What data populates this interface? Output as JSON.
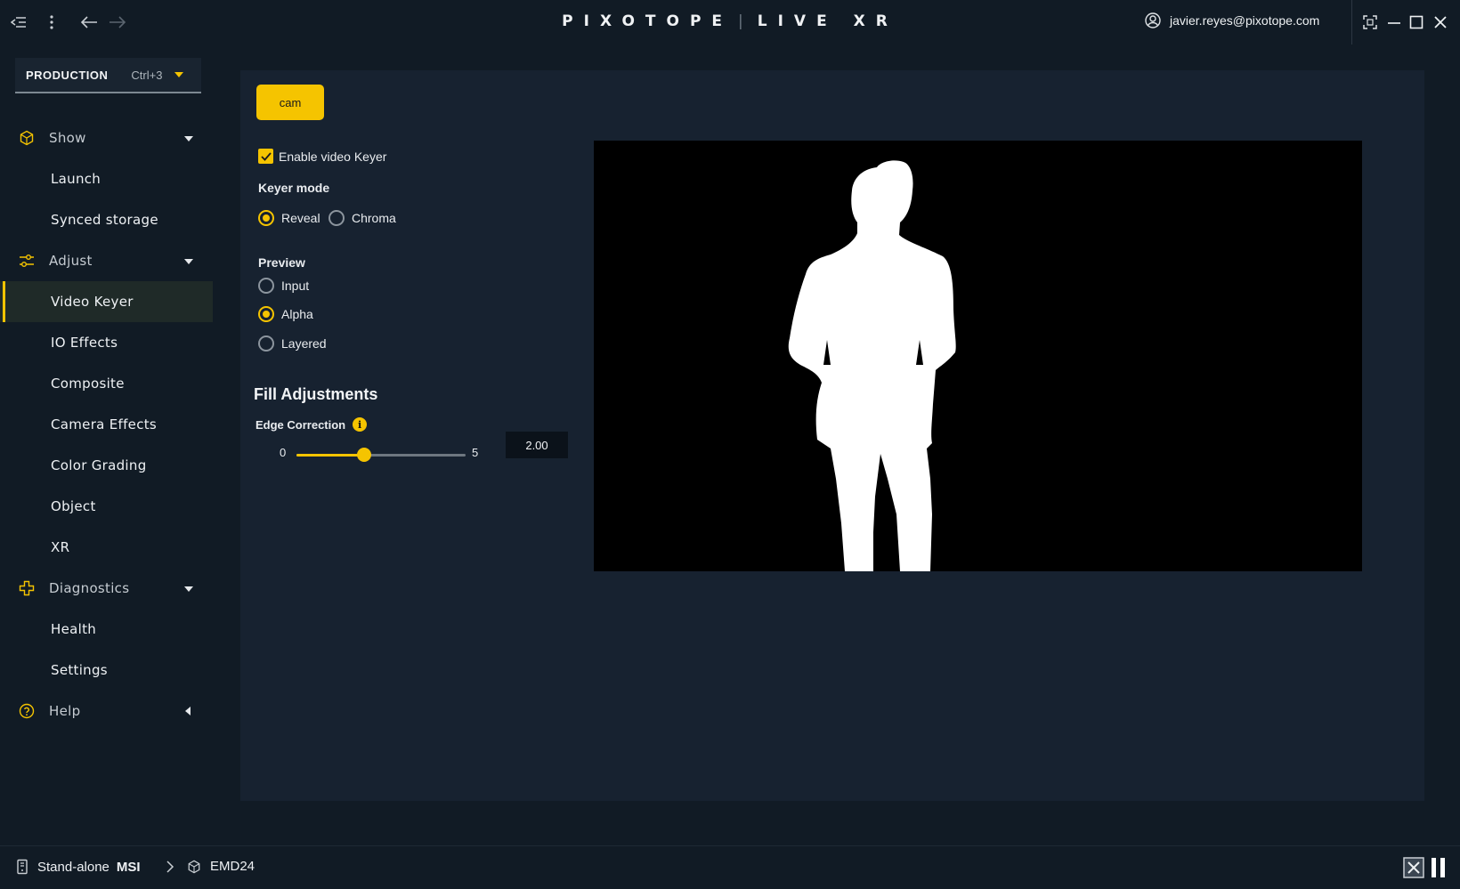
{
  "app": {
    "logo_left": "PIXOTOPE",
    "logo_right": "LIVE XR",
    "user_email": "javier.reyes@pixotope.com"
  },
  "production": {
    "name": "PRODUCTION",
    "shortcut": "Ctrl+3"
  },
  "nav": {
    "show": "Show",
    "launch": "Launch",
    "synced_storage": "Synced storage",
    "adjust": "Adjust",
    "video_keyer": "Video Keyer",
    "io_effects": "IO Effects",
    "composite": "Composite",
    "camera_effects": "Camera Effects",
    "color_grading": "Color Grading",
    "object": "Object",
    "xr": "XR",
    "diagnostics": "Diagnostics",
    "health": "Health",
    "settings": "Settings",
    "help": "Help"
  },
  "keyer": {
    "camera_tab": "cam",
    "enable_label": "Enable video Keyer",
    "enabled": true,
    "mode_label": "Keyer mode",
    "mode_options": [
      "Reveal",
      "Chroma"
    ],
    "mode_selected": "Reveal",
    "preview_label": "Preview",
    "preview_options": [
      "Input",
      "Alpha",
      "Layered"
    ],
    "preview_selected": "Alpha",
    "fill_title": "Fill Adjustments",
    "edge_label": "Edge Correction",
    "edge_min": "0",
    "edge_max": "5",
    "edge_value": "2.00",
    "edge_fraction": 0.4
  },
  "status": {
    "mode": "Stand-alone",
    "machine": "MSI",
    "station": "EMD24"
  },
  "colors": {
    "accent": "#f5c400",
    "background": "#111b25",
    "panel": "#172230"
  }
}
